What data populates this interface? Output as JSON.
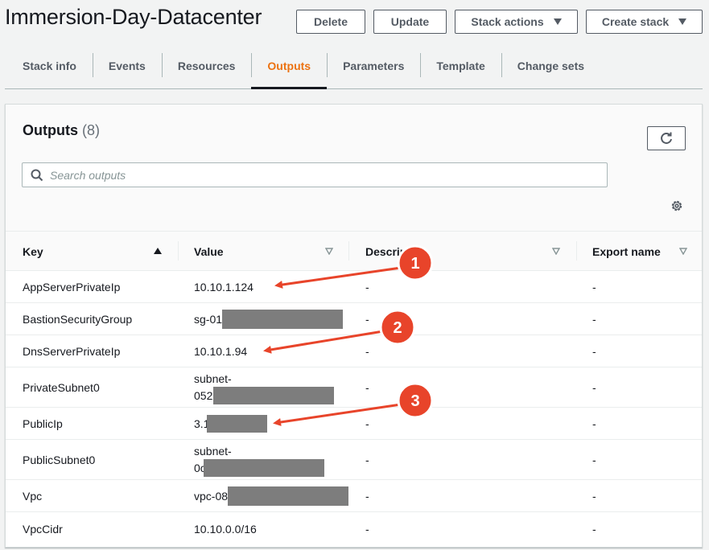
{
  "header": {
    "title": "Immersion-Day-Datacenter",
    "delete_label": "Delete",
    "update_label": "Update",
    "stack_actions_label": "Stack actions",
    "create_stack_label": "Create stack"
  },
  "tabs": [
    {
      "label": "Stack info",
      "active": false
    },
    {
      "label": "Events",
      "active": false
    },
    {
      "label": "Resources",
      "active": false
    },
    {
      "label": "Outputs",
      "active": true
    },
    {
      "label": "Parameters",
      "active": false
    },
    {
      "label": "Template",
      "active": false
    },
    {
      "label": "Change sets",
      "active": false
    }
  ],
  "panel": {
    "title": "Outputs",
    "count": "(8)",
    "search_placeholder": "Search outputs"
  },
  "table": {
    "columns": [
      "Key",
      "Value",
      "Description",
      "Export name"
    ],
    "rows": [
      {
        "key": "AppServerPrivateIp",
        "value": [
          "10.10.1.124"
        ],
        "description": "-",
        "export": "-"
      },
      {
        "key": "BastionSecurityGroup",
        "value": [
          "sg-01"
        ],
        "description": "-",
        "export": "-"
      },
      {
        "key": "DnsServerPrivateIp",
        "value": [
          "10.10.1.94"
        ],
        "description": "-",
        "export": "-"
      },
      {
        "key": "PrivateSubnet0",
        "value": [
          "subnet-",
          "052c"
        ],
        "description": "-",
        "export": "-"
      },
      {
        "key": "PublicIp",
        "value": [
          "3.1"
        ],
        "description": "-",
        "export": "-"
      },
      {
        "key": "PublicSubnet0",
        "value": [
          "subnet-",
          "0c"
        ],
        "description": "-",
        "export": "-"
      },
      {
        "key": "Vpc",
        "value": [
          "vpc-08"
        ],
        "description": "-",
        "export": "-"
      },
      {
        "key": "VpcCidr",
        "value": [
          "10.10.0.0/16"
        ],
        "description": "-",
        "export": "-"
      }
    ]
  },
  "annotations": [
    {
      "number": "1"
    },
    {
      "number": "2"
    },
    {
      "number": "3"
    }
  ],
  "colors": {
    "accent": "#ec7211",
    "annotation": "#e8442a",
    "redaction": "#7d7d7d"
  }
}
